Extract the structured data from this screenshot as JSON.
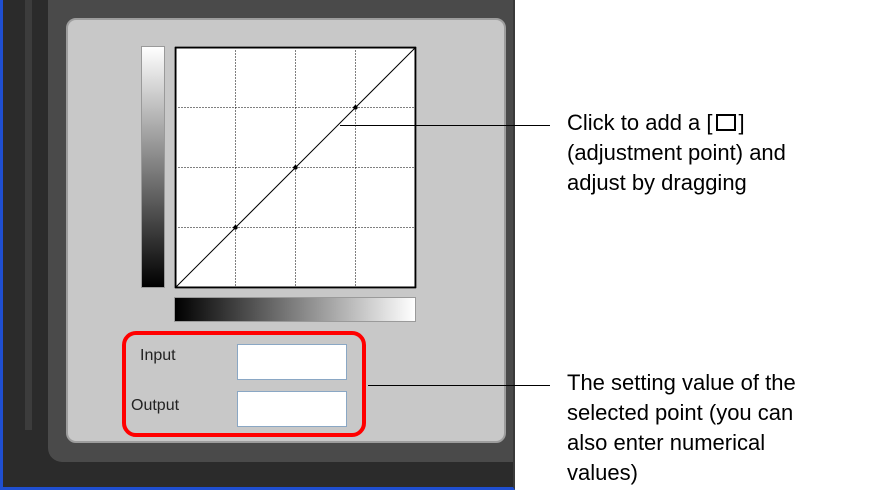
{
  "fields": {
    "input_label": "Input",
    "output_label": "Output",
    "input_value": "",
    "output_value": ""
  },
  "callouts": {
    "top": {
      "line1_prefix": "Click to add a [",
      "line1_suffix": "]",
      "icon": "square-adjustment-point-icon",
      "line2": "(adjustment point) and",
      "line3": "adjust by dragging"
    },
    "bottom": {
      "line1": "The setting value of the",
      "line2": "selected point (you can",
      "line3": "also enter numerical",
      "line4": "values)"
    }
  },
  "curve": {
    "grid_divisions": 4,
    "points": [
      [
        0,
        0
      ],
      [
        0.25,
        0.25
      ],
      [
        0.5,
        0.5
      ],
      [
        0.75,
        0.75
      ],
      [
        1,
        1
      ]
    ]
  },
  "colors": {
    "highlight": "#ff0000",
    "window_border": "#1f4fd1",
    "panel": "#c8c8c8"
  }
}
